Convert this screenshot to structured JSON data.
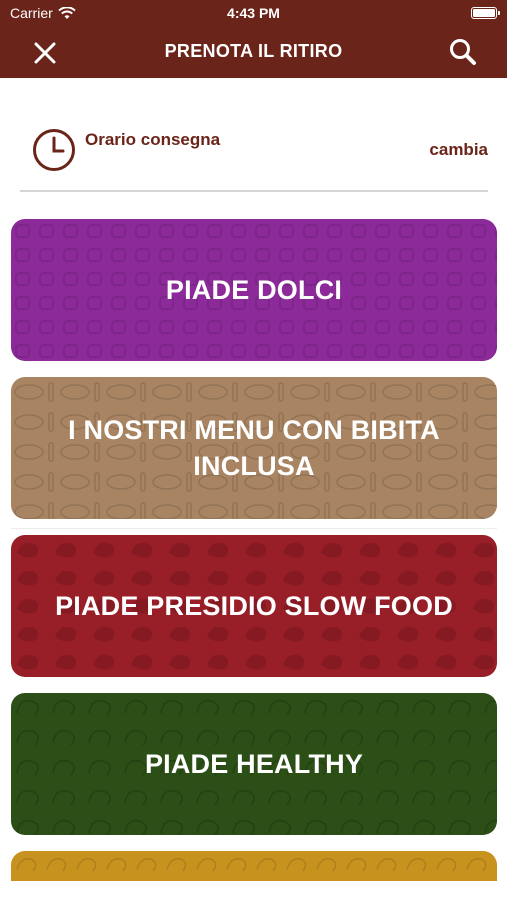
{
  "status_bar": {
    "carrier": "Carrier",
    "time": "4:43 PM"
  },
  "nav": {
    "title": "PRENOTA IL RITIRO",
    "close_icon": "close-icon",
    "search_icon": "search-icon"
  },
  "delivery": {
    "label": "Orario consegna",
    "change": "cambia",
    "icon": "clock-icon"
  },
  "categories": [
    {
      "label": "PIADE DOLCI",
      "color": "#8c2a9a"
    },
    {
      "label": "I NOSTRI MENU CON BIBITA INCLUSA",
      "color": "#a88462"
    },
    {
      "label": "PIADE PRESIDIO SLOW FOOD",
      "color": "#981e27"
    },
    {
      "label": "PIADE HEALTHY",
      "color": "#2b4f16"
    },
    {
      "label": "",
      "color": "#c8921f"
    }
  ],
  "colors": {
    "brand": "#6b2419"
  }
}
